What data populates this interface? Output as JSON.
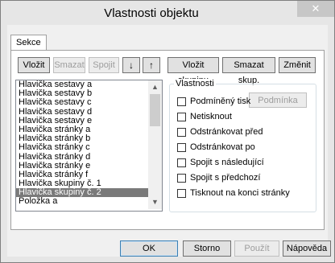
{
  "window": {
    "title": "Vlastnosti objektu",
    "close_glyph": "✕"
  },
  "tabs": [
    {
      "label": "Sekce"
    }
  ],
  "toolbar": {
    "add": "Vložit",
    "delete": "Smazat",
    "join": "Spojit",
    "move_down_glyph": "↓",
    "move_up_glyph": "↑",
    "add_group": "Vložit skupinu",
    "delete_group": "Smazat skup.",
    "change": "Změnit"
  },
  "sections_list": {
    "items": [
      "Hlavička sestavy a",
      "Hlavička sestavy b",
      "Hlavička sestavy c",
      "Hlavička sestavy d",
      "Hlavička sestavy e",
      "Hlavička stránky a",
      "Hlavička stránky b",
      "Hlavička stránky c",
      "Hlavička stránky d",
      "Hlavička stránky e",
      "Hlavička stránky f",
      "Hlavička skupiny č. 1",
      "Hlavička skupiny č. 2",
      "Položka a"
    ],
    "selected_index": 12,
    "scroll_up_glyph": "▲",
    "scroll_down_glyph": "▼"
  },
  "properties": {
    "legend": "Vlastnosti",
    "condition_button": "Podmínka",
    "checkboxes": [
      {
        "label": "Podmíněný tisk",
        "checked": false
      },
      {
        "label": "Netisknout",
        "checked": false
      },
      {
        "label": "Odstránkovat před",
        "checked": false
      },
      {
        "label": "Odstránkovat po",
        "checked": false
      },
      {
        "label": "Spojit s následující",
        "checked": false
      },
      {
        "label": "Spojit s předchozí",
        "checked": false
      },
      {
        "label": "Tisknout na konci stránky",
        "checked": false
      }
    ]
  },
  "footer": {
    "ok": "OK",
    "cancel": "Storno",
    "apply": "Použít",
    "help": "Nápověda"
  }
}
